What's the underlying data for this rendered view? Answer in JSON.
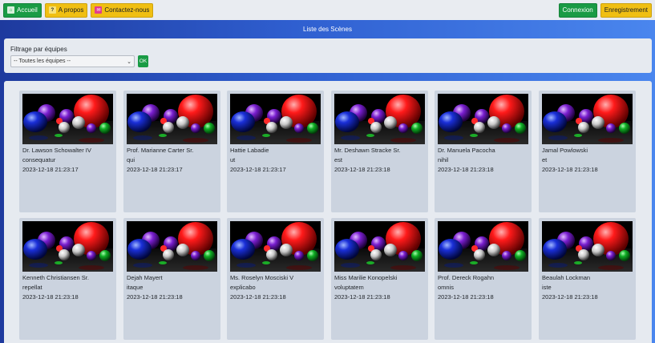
{
  "nav": {
    "left": [
      {
        "label": "Accueil",
        "icon": "home-icon",
        "color": "#1a9b45"
      },
      {
        "label": "A propos",
        "icon": "question-icon",
        "color": "#f0bf12"
      },
      {
        "label": "Contactez-nous",
        "icon": "mail-icon",
        "color": "#f0bf12"
      }
    ],
    "right": [
      {
        "label": "Connexion",
        "color": "#1a9b45"
      },
      {
        "label": "Enregistrement",
        "color": "#f0bf12"
      }
    ]
  },
  "banner": {
    "title": "Liste des Scènes"
  },
  "filter": {
    "label": "Filtrage par équipes",
    "selected": "-- Toutes les équipes --",
    "ok_label": "OK"
  },
  "scenes": [
    {
      "author": "Dr. Lawson Schowalter IV",
      "title": "consequatur",
      "date": "2023-12-18 21:23:17"
    },
    {
      "author": "Prof. Marianne Carter Sr.",
      "title": "qui",
      "date": "2023-12-18 21:23:17"
    },
    {
      "author": "Hattie Labadie",
      "title": "ut",
      "date": "2023-12-18 21:23:17"
    },
    {
      "author": "Mr. Deshawn Stracke Sr.",
      "title": "est",
      "date": "2023-12-18 21:23:18"
    },
    {
      "author": "Dr. Manuela Pacocha",
      "title": "nihil",
      "date": "2023-12-18 21:23:18"
    },
    {
      "author": "Jamal Powlowski",
      "title": "et",
      "date": "2023-12-18 21:23:18"
    },
    {
      "author": "Kenneth Christiansen Sr.",
      "title": "repellat",
      "date": "2023-12-18 21:23:18"
    },
    {
      "author": "Dejah Mayert",
      "title": "itaque",
      "date": "2023-12-18 21:23:18"
    },
    {
      "author": "Ms. Roselyn Mosciski V",
      "title": "explicabo",
      "date": "2023-12-18 21:23:18"
    },
    {
      "author": "Miss Marilie Konopelski",
      "title": "voluptatem",
      "date": "2023-12-18 21:23:18"
    },
    {
      "author": "Prof. Dereck Rogahn",
      "title": "omnis",
      "date": "2023-12-18 21:23:18"
    },
    {
      "author": "Beaulah Lockman",
      "title": "iste",
      "date": "2023-12-18 21:23:18"
    }
  ]
}
